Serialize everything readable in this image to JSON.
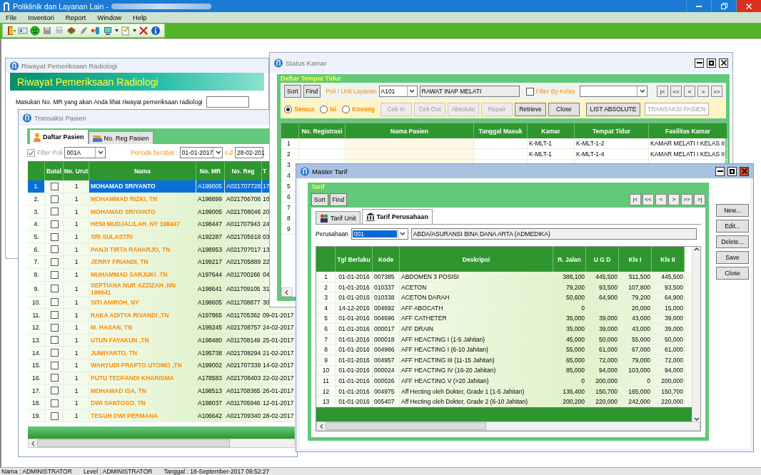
{
  "app": {
    "title": "Poliklinik dan Layanan Lain -",
    "menu": [
      "File",
      "Inventori",
      "Report",
      "Window",
      "Help"
    ]
  },
  "riwayat": {
    "title": "Riwayat Pemeriksaan Radiologi",
    "banner": "Riwayat Pemeriksaan Radiologi",
    "prompt": "Masukan No. MR yang akan Anda lihat riwayat pemeriksaan radiologi",
    "active": false
  },
  "transaksi": {
    "title": "Transaksi Pasien",
    "active": false,
    "tabs": [
      {
        "label": "Daftar Pasien",
        "selected": true
      },
      {
        "label": "No. Reg Pasien",
        "selected": false
      }
    ],
    "filter_poli": {
      "label": "Filter Poli",
      "checked": true,
      "disabled": true,
      "value": "001A"
    },
    "periode_label": "Periode berobat :",
    "periode_from": "01-01-2017",
    "sd_label": "s.d",
    "periode_to": "28-02-201",
    "columns": [
      "Batal",
      "No. Urut",
      "Nama",
      "No. MR",
      "No. Reg",
      "T"
    ],
    "rows": [
      {
        "no": "1.",
        "batal": false,
        "urut": "1",
        "nama": "MOHAMAD SRIYANTO",
        "mr": "A199005",
        "reg": "A021707728",
        "tanggal": "17",
        "selected": true
      },
      {
        "no": "2.",
        "batal": false,
        "urut": "1",
        "nama": "MOHAMMAD RIZKI, TN",
        "mr": "A198899",
        "reg": "A021706706",
        "tanggal": "10",
        "selected": false
      },
      {
        "no": "3.",
        "batal": false,
        "urut": "1",
        "nama": "MOHAMAD SRIYANTO",
        "mr": "A199005",
        "reg": "A021708046",
        "tanggal": "20",
        "selected": false
      },
      {
        "no": "4.",
        "batal": false,
        "urut": "1",
        "nama": "HENI MUDJALILAH .NY 198447",
        "mr": "A198447",
        "reg": "A011707943",
        "tanggal": "24",
        "selected": false
      },
      {
        "no": "5.",
        "batal": false,
        "urut": "1",
        "nama": "SRI SULASTRI",
        "mr": "A192287",
        "reg": "A021705618",
        "tanggal": "03",
        "selected": false
      },
      {
        "no": "6.",
        "batal": false,
        "urut": "1",
        "nama": "PANJI TIRTA RAHARJO, TN",
        "mr": "A198953",
        "reg": "A021707017",
        "tanggal": "13",
        "selected": false
      },
      {
        "no": "7.",
        "batal": false,
        "urut": "1",
        "nama": "JERRY FRIANDI, TN",
        "mr": "A199217",
        "reg": "A021705889",
        "tanggal": "22",
        "selected": false
      },
      {
        "no": "8.",
        "batal": false,
        "urut": "1",
        "nama": "MUHAMMAD SARJUKI .TN",
        "mr": "A197644",
        "reg": "A011700266",
        "tanggal": "04",
        "selected": false
      },
      {
        "no": "9.",
        "batal": false,
        "urut": "1",
        "nama": "SEPTIANA NUR AZZIZAH .NN 198641",
        "mr": "A198641",
        "reg": "A011709105",
        "tanggal": "31",
        "selected": false
      },
      {
        "no": "10.",
        "batal": false,
        "urut": "1",
        "nama": "SITI ANIROH, NY",
        "mr": "A198605",
        "reg": "A011708877",
        "tanggal": "30",
        "selected": false
      },
      {
        "no": "11.",
        "batal": false,
        "urut": "1",
        "nama": "RAKA ADITYA RIVANDI ,TN",
        "mr": "A197865",
        "reg": "A011705362",
        "tanggal": "09-01-2017",
        "selected": false
      },
      {
        "no": "12.",
        "batal": false,
        "urut": "1",
        "nama": "M. HASAN, TN",
        "mr": "A199245",
        "reg": "A021708757",
        "tanggal": "24-02-2017",
        "selected": false
      },
      {
        "no": "13.",
        "batal": false,
        "urut": "1",
        "nama": "UTUN FAYAKUN ,TN",
        "mr": "A198480",
        "reg": "A011708149",
        "tanggal": "25-01-2017",
        "selected": false
      },
      {
        "no": "14.",
        "batal": false,
        "urut": "1",
        "nama": "JUMIYANTO, TN",
        "mr": "A195738",
        "reg": "A021708294",
        "tanggal": "21-02-2017",
        "selected": false
      },
      {
        "no": "15.",
        "batal": false,
        "urut": "1",
        "nama": "WAHYUDI PRAPTO UTOMO ,TN",
        "mr": "A199002",
        "reg": "A021707339",
        "tanggal": "14-02-2017",
        "selected": false
      },
      {
        "no": "16.",
        "batal": false,
        "urut": "1",
        "nama": "PUTU TEOFANDI KHARISMA",
        "mr": "A178583",
        "reg": "A021708403",
        "tanggal": "22-02-2017",
        "selected": false
      },
      {
        "no": "17.",
        "batal": false,
        "urut": "1",
        "nama": "MOHAMAD ISA, TN",
        "mr": "A198513",
        "reg": "A011708365",
        "tanggal": "26-01-2017",
        "selected": false
      },
      {
        "no": "18.",
        "batal": false,
        "urut": "1",
        "nama": "DWI SANTOSO, TN",
        "mr": "A198037",
        "reg": "A011705946",
        "tanggal": "12-01-2017",
        "selected": false
      },
      {
        "no": "19.",
        "batal": false,
        "urut": "1",
        "nama": "TEGUH DWI PERMANA",
        "mr": "A106642",
        "reg": "A021709340",
        "tanggal": "28-02-2017",
        "selected": false
      }
    ]
  },
  "status_kamar": {
    "title": "Status Kamar",
    "active": false,
    "group": "Daftar Tempat Tidur",
    "sort": "Sort",
    "find": "Find",
    "poli_label": "Poli / Unit Layanan",
    "poli_code": "A101",
    "poli_name": "RAWAT INAP MELATI",
    "filter_kelas": {
      "label": "Filter By Kelas",
      "checked": false
    },
    "nav": [
      "|<",
      "<<",
      "<",
      ">",
      ">>"
    ],
    "radios": [
      {
        "label": "Semua",
        "selected": true
      },
      {
        "label": "Isi",
        "selected": false
      },
      {
        "label": "Kosong",
        "selected": false
      }
    ],
    "buttons": [
      {
        "label": "Cek In",
        "disabled": true
      },
      {
        "label": "Cek Out",
        "disabled": true
      },
      {
        "label": "Absolute",
        "disabled": true
      },
      {
        "label": "Repair",
        "disabled": true
      },
      {
        "label": "Retrieve",
        "disabled": false
      },
      {
        "label": "Close",
        "disabled": false
      }
    ],
    "list_button": "LIST ABSOLUTE",
    "transaksi_button": "TRANSAKSI PASIEN",
    "columns": [
      "No. Registrasi",
      "Nama Pasien",
      "Tanggal Masuk",
      "Kamar",
      "Tempat Tidur",
      "Fasilitas Kamar"
    ],
    "rows": [
      {
        "no": "1",
        "cells": [
          "",
          "",
          "",
          "K-MLT-1",
          "K-MLT-1-2",
          "KAMAR MELATI I  KELAS II"
        ]
      },
      {
        "no": "2",
        "cells": [
          "",
          "",
          "",
          "K-MLT-1",
          "K-MLT-1-4",
          "KAMAR MELATI I  KELAS II"
        ]
      },
      {
        "no": "3"
      },
      {
        "no": "4"
      },
      {
        "no": "5"
      },
      {
        "no": "6"
      },
      {
        "no": "7"
      },
      {
        "no": "8"
      },
      {
        "no": "9"
      }
    ]
  },
  "master_tarif": {
    "title": "Master Tarif",
    "active": true,
    "group": "Tarif",
    "sort": "Sort",
    "find": "Find",
    "nav": [
      "|<",
      "<<",
      "<",
      ">",
      ">>",
      ">|"
    ],
    "tabs": [
      {
        "label": "Tarif Unit",
        "selected": false
      },
      {
        "label": "Tarif Perusahaan",
        "selected": true
      }
    ],
    "perusahaan_label": "Perusahaan",
    "perusahaan_code": "001",
    "perusahaan_name": "ABDA/ASURANSI BINA DANA ARTA (ADMEDIKA)",
    "columns": [
      "",
      "Tgl Berlaku",
      "Kode",
      "Deskripsi",
      "R. Jalan",
      "U G D",
      "Kls I",
      "Kls II"
    ],
    "rows": [
      [
        "1",
        "01-01-2016",
        "007385",
        "ABDOMEN 3 POSISI",
        "386,100",
        "445,500",
        "511,500",
        "445,500"
      ],
      [
        "2",
        "01-01-2016",
        "010337",
        "ACETON",
        "79,200",
        "93,500",
        "107,800",
        "93,500"
      ],
      [
        "3",
        "01-01-2016",
        "010338",
        "ACETON DARAH",
        "50,600",
        "64,900",
        "79,200",
        "64,900"
      ],
      [
        "4",
        "14-12-2016",
        "004692",
        "AFF ABOCATH",
        "0",
        null,
        "20,000",
        "15,000"
      ],
      [
        "5",
        "01-01-2016",
        "004696",
        "AFF CATHETER",
        "35,000",
        "39,000",
        "43,000",
        "39,000"
      ],
      [
        "6",
        "01-01-2016",
        "000017",
        "AFF DRAIN",
        "35,000",
        "39,000",
        "43,000",
        "39,000"
      ],
      [
        "7",
        "01-01-2016",
        "000018",
        "AFF HEACTING I (1-5 Jahitan)",
        "45,000",
        "50,000",
        "55,000",
        "50,000"
      ],
      [
        "8",
        "01-01-2016",
        "004966",
        "AFF HEACTING I (6-10 Jahitan)",
        "55,000",
        "61,000",
        "67,000",
        "61,000"
      ],
      [
        "9",
        "01-01-2016",
        "004957",
        "AFF HEACTING III (11-15 Jahitan)",
        "65,000",
        "72,000",
        "79,000",
        "72,000"
      ],
      [
        "10",
        "01-01-2016",
        "000024",
        "AFF HEACTING IV (16-20 Jahitan)",
        "85,000",
        "94,000",
        "103,000",
        "94,000"
      ],
      [
        "11",
        "01-01-2016",
        "000026",
        "AFF HEACTING V (>20 Jahitan)",
        "0",
        "200,000",
        "0",
        "200,000"
      ],
      [
        "12",
        "01-01-2016",
        "004975",
        "Aff Hecting oleh Dokter, Grade 1 (1-5 Jahitan)",
        "136,400",
        "150,700",
        "165,000",
        "150,700"
      ],
      [
        "13",
        "01-01-2016",
        "005407",
        "Aff Hecting oleh Dokter, Grade 2 (6-10 Jahitan)",
        "200,200",
        "220,000",
        "242,000",
        "220,000"
      ]
    ],
    "side_buttons": [
      "New...",
      "Edit...",
      "Delete...",
      "Save",
      "Close"
    ]
  },
  "status_bar": {
    "nama": "Nama : ADMINISTRATOR",
    "level": "Level : ADMINISTRATOR",
    "tanggal": "Tanggal : 18-September-2017  09:52:27"
  }
}
